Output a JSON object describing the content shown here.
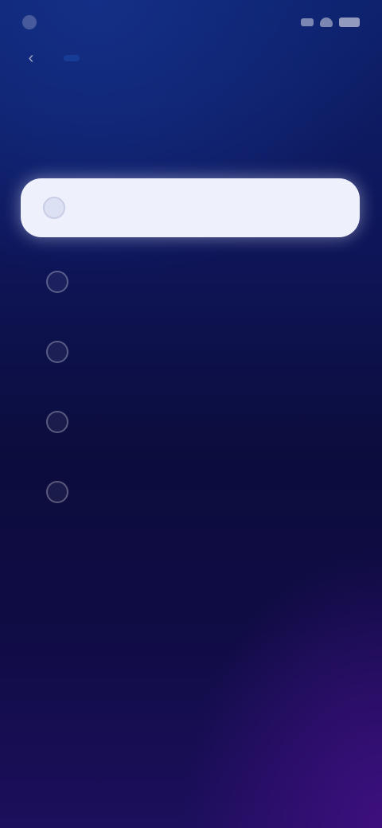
{
  "status_bar": {
    "time": "",
    "icons": [
      "signal-icon",
      "wifi-icon",
      "battery-icon"
    ]
  },
  "nav": {
    "back_icon": "chevron-left-icon",
    "back_glyph": "‹",
    "tab_label": ""
  },
  "question": {
    "text": ""
  },
  "options": [
    {
      "label": "",
      "selected": true
    },
    {
      "label": "",
      "selected": false
    },
    {
      "label": "",
      "selected": false
    },
    {
      "label": "",
      "selected": false
    },
    {
      "label": "",
      "selected": false
    }
  ],
  "colors": {
    "accent": "#3aa7ff",
    "background_top": "#0d216b",
    "background_bottom": "#1c0f5c",
    "selected_fill": "#eef0fb"
  }
}
